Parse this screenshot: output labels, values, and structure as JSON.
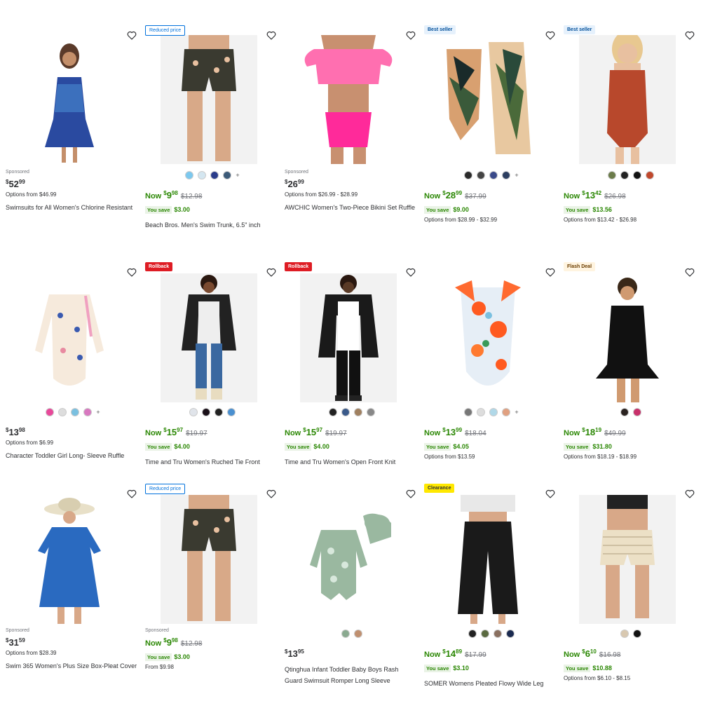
{
  "products": [
    {
      "sponsored": "Sponsored",
      "price_int": "52",
      "price_dec": "99",
      "options": "Options from $46.99",
      "title": "Swimsuits for All Women's Chlorine Resistant",
      "swatches": [],
      "img": "white"
    },
    {
      "badge": "Reduced price",
      "badge_type": "reduced",
      "now_label": "Now",
      "price_int": "9",
      "price_dec": "98",
      "was": "$12.98",
      "save_label": "You save",
      "save_amount": "$3.00",
      "title": "Beach Bros. Men's Swim Trunk, 6.5\" inch",
      "swatches": [
        "#7cc8ee",
        "#d4e6f0",
        "#2a3c8a",
        "#3c5a78"
      ],
      "more": "+"
    },
    {
      "sponsored": "Sponsored",
      "price_int": "26",
      "price_dec": "99",
      "options": "Options from $26.99 - $28.99",
      "title": "AWCHIC Women's Two-Piece Bikini Set Ruffle",
      "swatches": [],
      "img": "white"
    },
    {
      "badge": "Best seller",
      "badge_type": "best",
      "now_label": "Now",
      "price_int": "28",
      "price_dec": "99",
      "was": "$37.99",
      "save_label": "You save",
      "save_amount": "$9.00",
      "options": "Options from $28.99 - $32.99",
      "swatches": [
        "#2a2a2a",
        "#444",
        "#3a4a8a",
        "#2c3e60"
      ],
      "more": "+",
      "img": "white"
    },
    {
      "badge": "Best seller",
      "badge_type": "best",
      "now_label": "Now",
      "price_int": "13",
      "price_dec": "42",
      "was": "$26.98",
      "save_label": "You save",
      "save_amount": "$13.56",
      "options": "Options from $13.42 - $26.98",
      "swatches": [
        "#6b7b4a",
        "#222",
        "#111",
        "#c0482c"
      ]
    },
    {
      "price_int": "13",
      "price_dec": "98",
      "options": "Options from $6.99",
      "title": "Character Toddler Girl Long- Sleeve Ruffle",
      "swatches": [
        "#e8489a",
        "#ddd",
        "#7ac0e0",
        "#d878c0"
      ],
      "more": "+",
      "img": "white"
    },
    {
      "badge": "Rollback",
      "badge_type": "rollback",
      "now_label": "Now",
      "price_int": "15",
      "price_dec": "97",
      "was": "$19.97",
      "save_label": "You save",
      "save_amount": "$4.00",
      "title": "Time and Tru Women's Ruched Tie Front",
      "swatches": [
        "#e0e4ea",
        "#1a1018",
        "#222",
        "#4a90d0"
      ]
    },
    {
      "badge": "Rollback",
      "badge_type": "rollback",
      "now_label": "Now",
      "price_int": "15",
      "price_dec": "97",
      "was": "$19.97",
      "save_label": "You save",
      "save_amount": "$4.00",
      "title": "Time and Tru Women's Open Front Knit",
      "swatches": [
        "#222",
        "#3a5a8a",
        "#a08060",
        "#888"
      ]
    },
    {
      "now_label": "Now",
      "price_int": "13",
      "price_dec": "99",
      "was": "$18.04",
      "save_label": "You save",
      "save_amount": "$4.05",
      "options": "Options from $13.59",
      "swatches": [
        "#777",
        "#ddd",
        "#b0d8e8",
        "#e0a080"
      ],
      "more": "+",
      "img": "white"
    },
    {
      "badge": "Flash Deal",
      "badge_type": "flash",
      "now_label": "Now",
      "price_int": "18",
      "price_dec": "19",
      "was": "$49.99",
      "save_label": "You save",
      "save_amount": "$31.80",
      "options": "Options from $18.19 - $18.99",
      "swatches": [
        "#2a2220",
        "#c8306a"
      ],
      "img": "white"
    },
    {
      "sponsored": "Sponsored",
      "price_int": "31",
      "price_dec": "59",
      "options": "Options from $28.39",
      "title": "Swim 365 Women's Plus Size Box-Pleat Cover",
      "swatches": [],
      "img": "white"
    },
    {
      "badge": "Reduced price",
      "badge_type": "reduced",
      "sponsored": "Sponsored",
      "now_label": "Now",
      "price_int": "9",
      "price_dec": "98",
      "was": "$12.98",
      "save_label": "You save",
      "save_amount": "$3.00",
      "options": "From $9.98",
      "swatches": []
    },
    {
      "price_int": "13",
      "price_dec": "95",
      "title": "Qtinghua Infant Toddler Baby Boys Rash",
      "title2": "Guard Swimsuit Romper Long Sleeve",
      "swatches": [
        "#8aaa90",
        "#c09070"
      ],
      "img": "white"
    },
    {
      "badge": "Clearance",
      "badge_type": "clearance",
      "now_label": "Now",
      "price_int": "14",
      "price_dec": "89",
      "was": "$17.99",
      "save_label": "You save",
      "save_amount": "$3.10",
      "title": "SOMER Womens Pleated Flowy Wide Leg",
      "swatches": [
        "#222",
        "#5a6a40",
        "#8a7060",
        "#1a2a50"
      ],
      "img": "white"
    },
    {
      "now_label": "Now",
      "price_int": "6",
      "price_dec": "10",
      "was": "$16.98",
      "save_label": "You save",
      "save_amount": "$10.88",
      "options": "Options from $6.10 - $8.15",
      "swatches": [
        "#d8c8b0",
        "#111"
      ]
    }
  ],
  "colors": {
    "accent_blue": "#0071dc",
    "now_green": "#2a8703",
    "rollback_red": "#de1c24"
  }
}
